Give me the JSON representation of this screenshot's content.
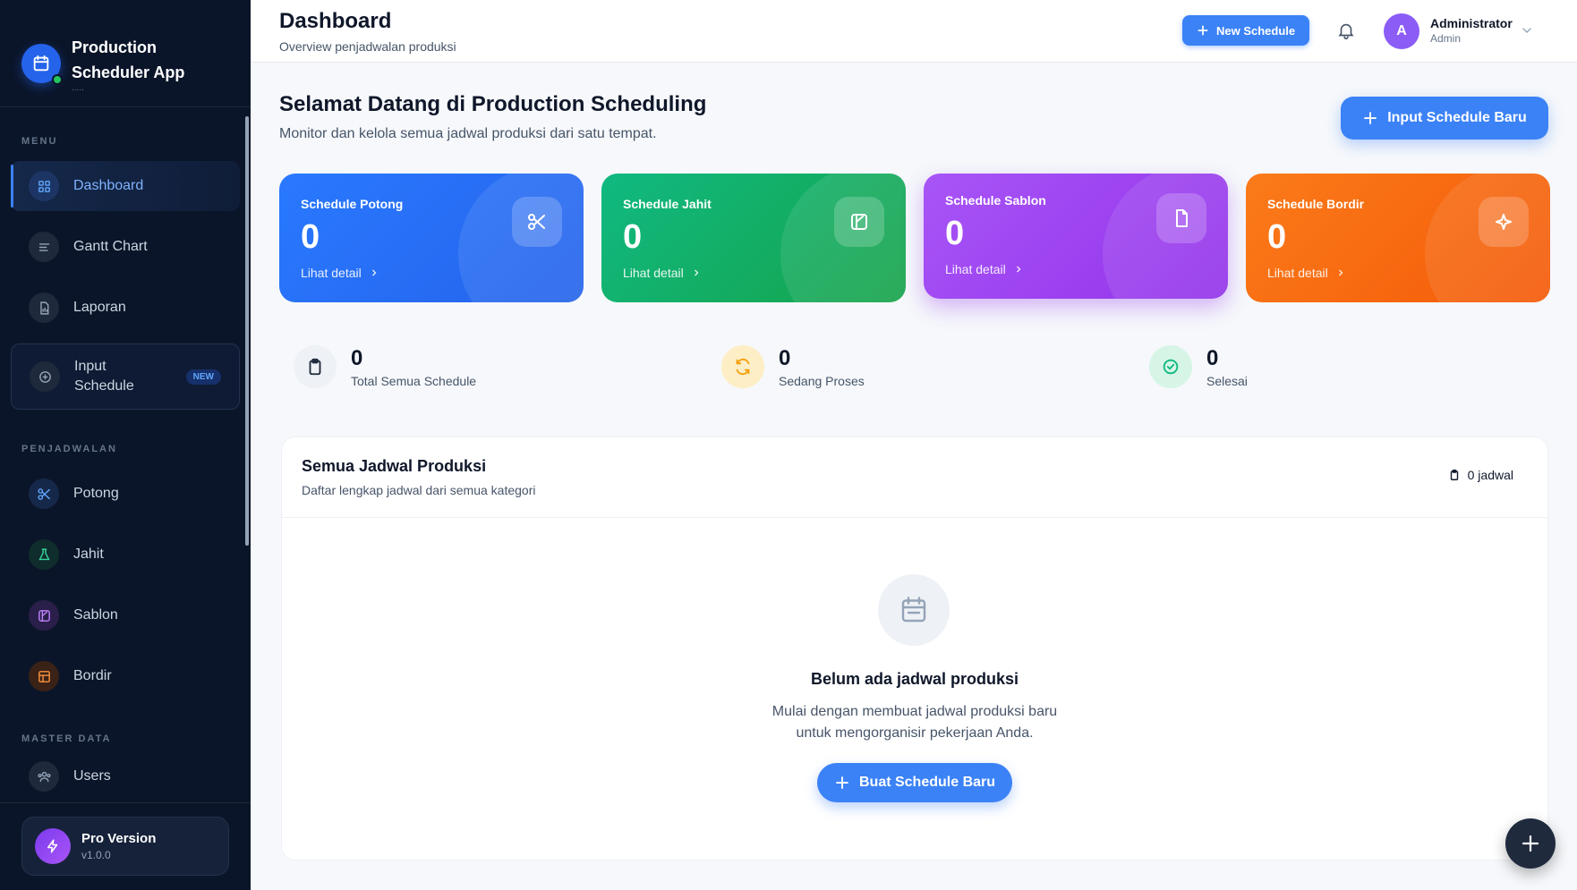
{
  "brand": {
    "title_line1": "Production",
    "title_line2": "Scheduler App",
    "subtitle": "....."
  },
  "sidebar": {
    "menu_label": "MENU",
    "menu_items": [
      {
        "label": "Dashboard",
        "icon": "grid-icon",
        "active": true
      },
      {
        "label": "Gantt Chart",
        "icon": "bars-icon"
      },
      {
        "label": "Laporan",
        "icon": "report-icon"
      },
      {
        "label_line1": "Input",
        "label_line2": "Schedule",
        "badge": "NEW",
        "icon": "plus-circle-icon"
      }
    ],
    "scheduling_label": "PENJADWALAN",
    "scheduling_items": [
      {
        "label": "Potong",
        "icon": "scissors-icon"
      },
      {
        "label": "Jahit",
        "icon": "flask-icon"
      },
      {
        "label": "Sablon",
        "icon": "palette-icon"
      },
      {
        "label": "Bordir",
        "icon": "layout-icon"
      }
    ],
    "master_label": "MASTER DATA",
    "master_items": [
      {
        "label": "Users",
        "icon": "users-icon"
      }
    ],
    "pro": {
      "title": "Pro Version",
      "version": "v1.0.0"
    }
  },
  "header": {
    "title": "Dashboard",
    "subtitle": "Overview penjadwalan produksi",
    "new_button": "New Schedule",
    "user": {
      "initial": "A",
      "name": "Administrator",
      "role": "Admin"
    }
  },
  "welcome": {
    "title": "Selamat Datang di Production Scheduling",
    "subtitle": "Monitor dan kelola semua jadwal produksi dari satu tempat.",
    "button": "Input Schedule Baru"
  },
  "cards": [
    {
      "label": "Schedule Potong",
      "value": "0",
      "link": "Lihat detail",
      "icon": "scissors-icon",
      "color": "#2979ff"
    },
    {
      "label": "Schedule Jahit",
      "value": "0",
      "link": "Lihat detail",
      "icon": "palette-icon",
      "color": "#10b981"
    },
    {
      "label": "Schedule Sablon",
      "value": "0",
      "link": "Lihat detail",
      "icon": "file-icon",
      "color": "#a855f7"
    },
    {
      "label": "Schedule Bordir",
      "value": "0",
      "link": "Lihat detail",
      "icon": "sparkle-icon",
      "color": "#fb7b1a"
    }
  ],
  "stats": [
    {
      "value": "0",
      "label": "Total Semua Schedule",
      "icon": "clipboard-icon"
    },
    {
      "value": "0",
      "label": "Sedang Proses",
      "icon": "refresh-icon"
    },
    {
      "value": "0",
      "label": "Selesai",
      "icon": "check-circle-icon"
    }
  ],
  "panel": {
    "title": "Semua Jadwal Produksi",
    "subtitle": "Daftar lengkap jadwal dari semua kategori",
    "count": "0 jadwal",
    "empty_title": "Belum ada jadwal produksi",
    "empty_line1": "Mulai dengan membuat jadwal produksi baru",
    "empty_line2": "untuk mengorganisir pekerjaan Anda.",
    "button": "Buat Schedule Baru"
  }
}
